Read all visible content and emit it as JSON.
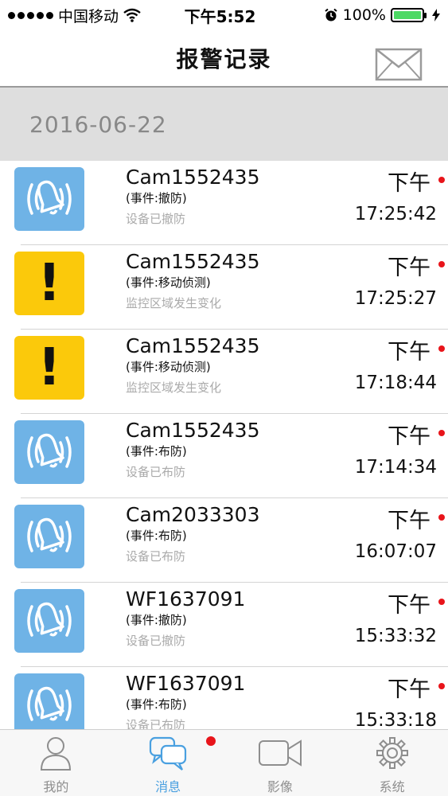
{
  "status_bar": {
    "carrier": "中国移动",
    "time": "下午5:52",
    "battery": "100%",
    "battery_level": 1.0
  },
  "nav": {
    "title": "报警记录"
  },
  "date_header": "2016-06-22",
  "records": [
    {
      "icon": "bell",
      "device": "Cam1552435",
      "event": "(事件:撤防)",
      "desc": "设备已撤防",
      "ampm": "下午",
      "time": "17:25:42"
    },
    {
      "icon": "alert",
      "device": "Cam1552435",
      "event": "(事件:移动侦测)",
      "desc": "监控区域发生变化",
      "ampm": "下午",
      "time": "17:25:27"
    },
    {
      "icon": "alert",
      "device": "Cam1552435",
      "event": "(事件:移动侦测)",
      "desc": "监控区域发生变化",
      "ampm": "下午",
      "time": "17:18:44"
    },
    {
      "icon": "bell",
      "device": "Cam1552435",
      "event": "(事件:布防)",
      "desc": "设备已布防",
      "ampm": "下午",
      "time": "17:14:34"
    },
    {
      "icon": "bell",
      "device": "Cam2033303",
      "event": "(事件:布防)",
      "desc": "设备已布防",
      "ampm": "下午",
      "time": "16:07:07"
    },
    {
      "icon": "bell",
      "device": "WF1637091",
      "event": "(事件:撤防)",
      "desc": "设备已撤防",
      "ampm": "下午",
      "time": "15:33:32"
    },
    {
      "icon": "bell",
      "device": "WF1637091",
      "event": "(事件:布防)",
      "desc": "设备已布防",
      "ampm": "下午",
      "time": "15:33:18"
    }
  ],
  "tabs": [
    {
      "label": "我的",
      "icon": "person-icon"
    },
    {
      "label": "消息",
      "icon": "chat-bubbles-icon"
    },
    {
      "label": "影像",
      "icon": "video-camera-icon"
    },
    {
      "label": "系统",
      "icon": "gear-icon"
    }
  ],
  "colors": {
    "bell_bg": "#6fb3e6",
    "alert_bg": "#fbc90b",
    "active_tab": "#4aa0e0",
    "unread": "#e8141a"
  }
}
